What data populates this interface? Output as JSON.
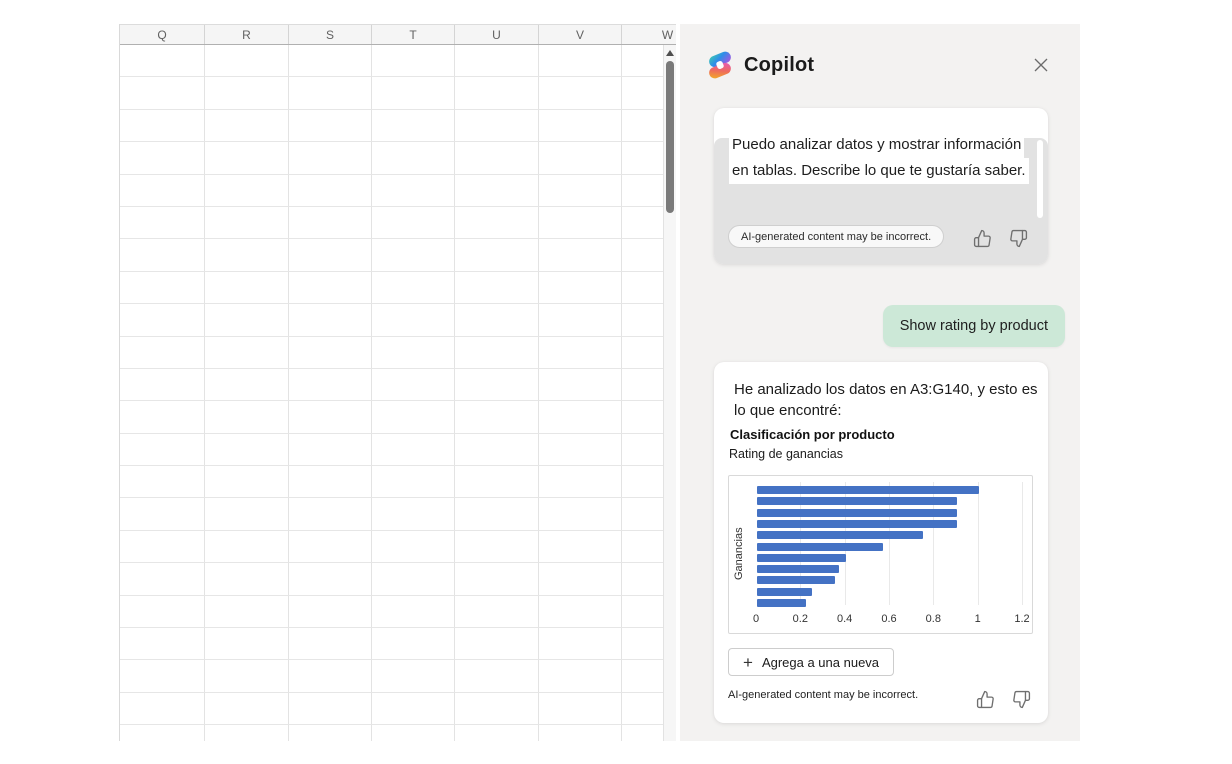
{
  "spreadsheet": {
    "columns": [
      "Q",
      "R",
      "S",
      "T",
      "U",
      "V",
      "W"
    ],
    "visible_rows": 22
  },
  "copilot": {
    "title": "Copilot",
    "welcome": {
      "lines": [
        "Puedo analizar datos y mostrar información",
        "en tablas. Describe lo que te gustaría saber."
      ],
      "disclaimer": "AI-generated content may be incorrect."
    },
    "user_message": "Show rating by product",
    "response": {
      "intro_lines": [
        "He analizado los datos en A3:G140, y esto es",
        "lo que encontré:"
      ],
      "add_button_label": "Agrega a una nueva",
      "plus_icon": "+",
      "disclaimer": "AI-generated content may be incorrect."
    }
  },
  "chart_data": {
    "type": "bar",
    "orientation": "horizontal",
    "title": "Clasificación por producto",
    "subtitle": "Rating de ganancias",
    "xlabel": "",
    "ylabel": "Ganancias",
    "values": [
      1.0,
      0.9,
      0.9,
      0.9,
      0.75,
      0.57,
      0.4,
      0.37,
      0.35,
      0.25,
      0.22
    ],
    "xticks": [
      0,
      0.2,
      0.4,
      0.6,
      0.8,
      1,
      1.2
    ],
    "xlim": [
      0,
      1.2
    ],
    "grid": true,
    "legend": false,
    "bar_color": "#4472c4"
  },
  "colors": {
    "panel_bg": "#f3f2f1",
    "welcome_block_bg": "#e2e2e2",
    "user_bubble_bg": "#cce8d7",
    "bar_color": "#4472c4",
    "grid_line": "#e3e3e3"
  }
}
